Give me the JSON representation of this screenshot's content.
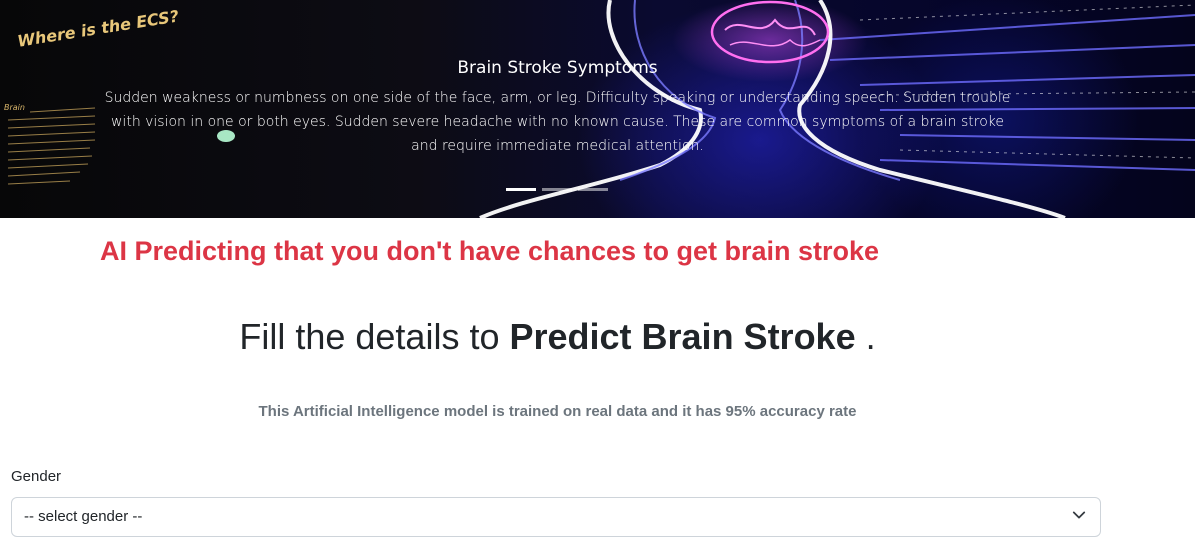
{
  "hero": {
    "image_text": "Where is the ECS?",
    "image_small_text": "Brain",
    "caption_title": "Brain Stroke Symptoms",
    "caption_body": "Sudden weakness or numbness on one side of the face, arm, or leg. Difficulty speaking or understanding speech. Sudden trouble with vision in one or both eyes. Sudden severe headache with no known cause. These are common symptoms of a brain stroke and require immediate medical attention.",
    "slide_count": 3,
    "active_slide": 1
  },
  "prediction_message": "AI Predicting that you don't have chances to get brain stroke",
  "headline": {
    "prefix": "Fill the details to",
    "emphasis": "Predict Brain Stroke",
    "suffix": "."
  },
  "subtitle": "This Artificial Intelligence model is trained on real data and it has 95% accuracy rate",
  "form": {
    "gender_label": "Gender",
    "gender_selected": "-- select gender --"
  },
  "colors": {
    "alert_red": "#dc3545",
    "muted_gray": "#6c757d"
  },
  "icons": {
    "select": "chevron-down-icon"
  }
}
